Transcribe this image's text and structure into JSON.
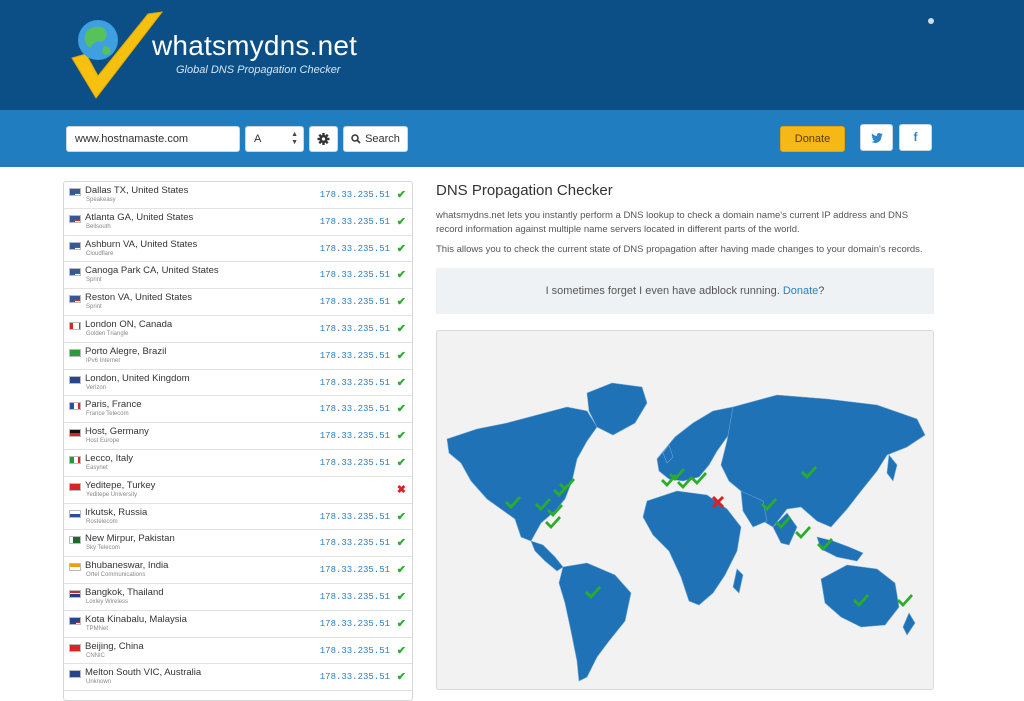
{
  "brand": {
    "name": "whatsmydns.net",
    "tagline": "Global DNS Propagation Checker"
  },
  "search": {
    "hostname_value": "www.hostnamaste.com",
    "record_type": "A",
    "search_label": "Search"
  },
  "actions": {
    "donate_label": "Donate",
    "twitter_icon_text": "🐦",
    "facebook_icon_text": "f"
  },
  "results": [
    {
      "location": "Dallas TX, United States",
      "provider": "Speakeasy",
      "ip": "178.33.235.51",
      "status": "ok",
      "flag": "us"
    },
    {
      "location": "Atlanta GA, United States",
      "provider": "Bellsouth",
      "ip": "178.33.235.51",
      "status": "ok",
      "flag": "us"
    },
    {
      "location": "Ashburn VA, United States",
      "provider": "Cloudflare",
      "ip": "178.33.235.51",
      "status": "ok",
      "flag": "us"
    },
    {
      "location": "Canoga Park CA, United States",
      "provider": "Sprint",
      "ip": "178.33.235.51",
      "status": "ok",
      "flag": "us"
    },
    {
      "location": "Reston VA, United States",
      "provider": "Sprint",
      "ip": "178.33.235.51",
      "status": "ok",
      "flag": "us"
    },
    {
      "location": "London ON, Canada",
      "provider": "Golden Triangle",
      "ip": "178.33.235.51",
      "status": "ok",
      "flag": "ca"
    },
    {
      "location": "Porto Alegre, Brazil",
      "provider": "IPv6 Internet",
      "ip": "178.33.235.51",
      "status": "ok",
      "flag": "br"
    },
    {
      "location": "London, United Kingdom",
      "provider": "Verizon",
      "ip": "178.33.235.51",
      "status": "ok",
      "flag": "uk"
    },
    {
      "location": "Paris, France",
      "provider": "France Telecom",
      "ip": "178.33.235.51",
      "status": "ok",
      "flag": "fr"
    },
    {
      "location": "Host, Germany",
      "provider": "Host Europe",
      "ip": "178.33.235.51",
      "status": "ok",
      "flag": "de"
    },
    {
      "location": "Lecco, Italy",
      "provider": "Easynet",
      "ip": "178.33.235.51",
      "status": "ok",
      "flag": "it"
    },
    {
      "location": "Yeditepe, Turkey",
      "provider": "Yeditepe University",
      "ip": "",
      "status": "fail",
      "flag": "tr"
    },
    {
      "location": "Irkutsk, Russia",
      "provider": "Rostelecom",
      "ip": "178.33.235.51",
      "status": "ok",
      "flag": "ru"
    },
    {
      "location": "New Mirpur, Pakistan",
      "provider": "Sky Telecom",
      "ip": "178.33.235.51",
      "status": "ok",
      "flag": "pk"
    },
    {
      "location": "Bhubaneswar, India",
      "provider": "Ortel Communications",
      "ip": "178.33.235.51",
      "status": "ok",
      "flag": "in"
    },
    {
      "location": "Bangkok, Thailand",
      "provider": "Loxley Wireless",
      "ip": "178.33.235.51",
      "status": "ok",
      "flag": "th"
    },
    {
      "location": "Kota Kinabalu, Malaysia",
      "provider": "TPMNet",
      "ip": "178.33.235.51",
      "status": "ok",
      "flag": "my"
    },
    {
      "location": "Beijing, China",
      "provider": "CNNIC",
      "ip": "178.33.235.51",
      "status": "ok",
      "flag": "cn"
    },
    {
      "location": "Melton South VIC, Australia",
      "provider": "Unknown",
      "ip": "178.33.235.51",
      "status": "ok",
      "flag": "au"
    }
  ],
  "main": {
    "title": "DNS Propagation Checker",
    "description": "whatsmydns.net lets you instantly perform a DNS lookup to check a domain name's current IP address and DNS record information against multiple name servers located in different parts of the world.",
    "description2": "This allows you to check the current state of DNS propagation after having made changes to your domain's records.",
    "adblock_prefix": "I sometimes forget I even have adblock running. ",
    "adblock_link": "Donate",
    "adblock_suffix": "?"
  },
  "colors": {
    "header": "#0b4f86",
    "toolbar": "#1f7dc0",
    "map_land": "#1f72b5",
    "ok": "#2aae2a",
    "fail": "#e02020",
    "ip": "#2d7ec1"
  }
}
